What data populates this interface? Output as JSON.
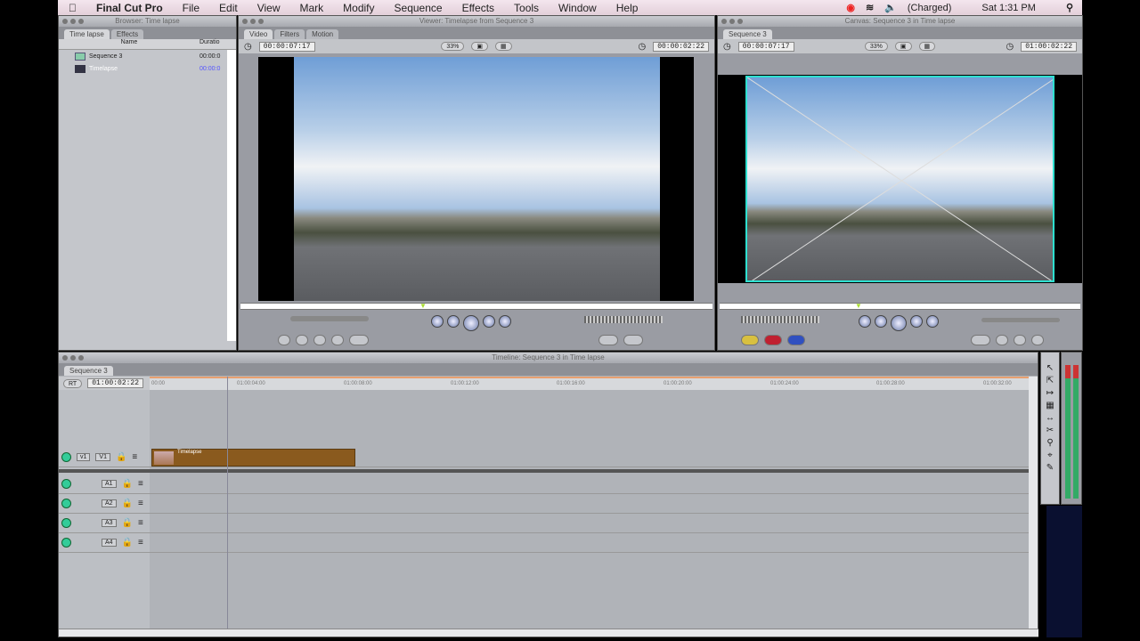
{
  "menubar": {
    "app": "Final Cut Pro",
    "items": [
      "File",
      "Edit",
      "View",
      "Mark",
      "Modify",
      "Sequence",
      "Effects",
      "Tools",
      "Window",
      "Help"
    ],
    "battery": "(Charged)",
    "clock": "Sat 1:31 PM"
  },
  "browser": {
    "title": "Browser: Time lapse",
    "tabs": [
      "Time lapse",
      "Effects"
    ],
    "col_name": "Name",
    "col_duration": "Duratio",
    "items": [
      {
        "name": "Sequence 3",
        "duration": "00:00:0"
      },
      {
        "name": "Timelapse",
        "duration": "00:00:0"
      }
    ]
  },
  "viewer": {
    "title": "Viewer: Timelapse from Sequence 3",
    "tabs": [
      "Video",
      "Filters",
      "Motion"
    ],
    "timecode_duration": "00:00:07:17",
    "timecode_current": "00:00:02:22",
    "zoom": "33%"
  },
  "canvas": {
    "title": "Canvas: Sequence 3 in Time lapse",
    "tab": "Sequence 3",
    "timecode_duration": "00:00:07:17",
    "timecode_current": "01:00:02:22",
    "zoom": "33%"
  },
  "timeline": {
    "title": "Timeline: Sequence 3 in Time lapse",
    "tab": "Sequence 3",
    "rt": "RT",
    "timecode": "01:00:02:22",
    "ruler": [
      "00:00",
      "01:00:04:00",
      "01:00:08:00",
      "01:00:12:00",
      "01:00:16:00",
      "01:00:20:00",
      "01:00:24:00",
      "01:00:28:00",
      "01:00:32:00"
    ],
    "video_track": {
      "src": "v1",
      "dst": "V1",
      "clip": "Timelapse"
    },
    "audio_tracks": [
      "A1",
      "A2",
      "A3",
      "A4"
    ]
  },
  "colors": {
    "clip": "#8a5a1e",
    "canvas_wireframe": "#2ee0d0"
  }
}
